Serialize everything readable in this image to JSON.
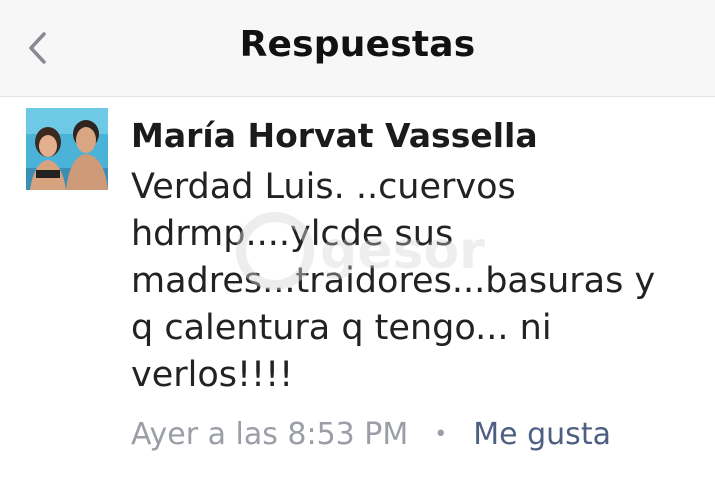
{
  "header": {
    "title": "Respuestas"
  },
  "reply": {
    "author": "María Horvat Vassella",
    "text": "Verdad Luis. ..cuervos hdrmp....ylcde sus madres...traidores...basuras y q calentura q tengo... ni verlos!!!!",
    "timestamp": "Ayer a las 8:53 PM",
    "separator": "•",
    "like_label": "Me gusta"
  },
  "watermark": {
    "text": "@gesor"
  },
  "icons": {
    "back": "chevron-left-icon",
    "avatar": "profile-photo"
  },
  "colors": {
    "header_bg": "#f7f7f8",
    "meta_gray": "#9b9ea6",
    "like_blue": "#4e5f82",
    "text": "#222222"
  }
}
